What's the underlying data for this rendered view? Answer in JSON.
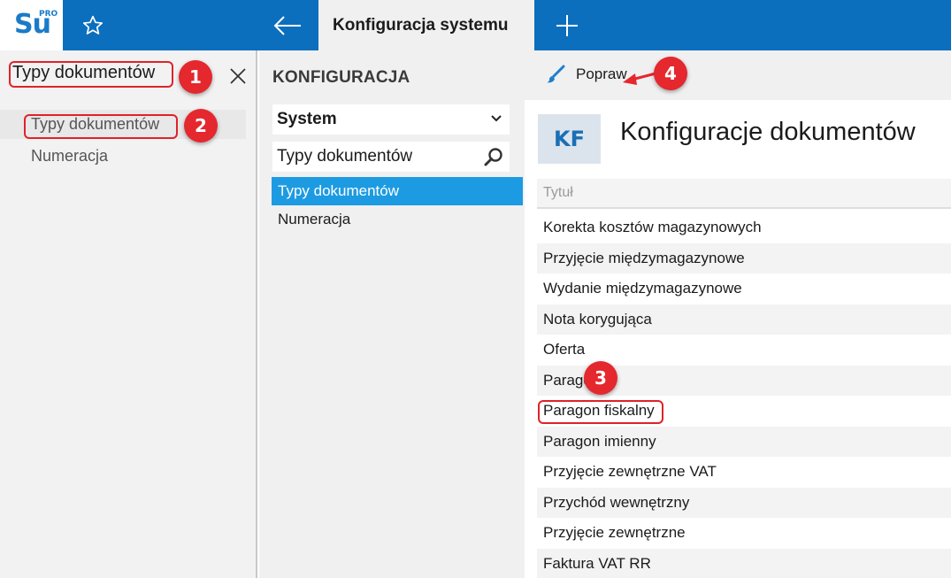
{
  "app": {
    "logo_text": "Su",
    "logo_super": "PRO"
  },
  "header": {
    "active_tab": "Konfiguracja systemu"
  },
  "left_panel": {
    "search_value": "Typy dokumentów",
    "items": [
      {
        "label": "Typy dokumentów"
      },
      {
        "label": "Numeracja"
      }
    ]
  },
  "middle_panel": {
    "title": "KONFIGURACJA",
    "select_value": "System",
    "search_value": "Typy dokumentów",
    "items": [
      {
        "label": "Typy dokumentów"
      },
      {
        "label": "Numeracja"
      }
    ]
  },
  "right_panel": {
    "edit_label": "Popraw",
    "tile": "KF",
    "title": "Konfiguracje dokumentów",
    "column_header": "Tytuł",
    "rows": [
      "Korekta kosztów magazynowych",
      "Przyjęcie międzymagazynowe",
      "Wydanie międzymagazynowe",
      "Nota korygująca",
      "Oferta",
      "Paragon",
      "Paragon fiskalny",
      "Paragon imienny",
      "Przyjęcie zewnętrzne VAT",
      "Przychód wewnętrzny",
      "Przyjęcie zewnętrzne",
      "Faktura VAT RR"
    ]
  },
  "annotations": {
    "badge_1": "1",
    "badge_2": "2",
    "badge_3": "3",
    "badge_4": "4"
  },
  "colors": {
    "header_blue": "#0b6fbd",
    "selection_blue": "#1d9be2",
    "annotation_red": "#e5272e"
  }
}
